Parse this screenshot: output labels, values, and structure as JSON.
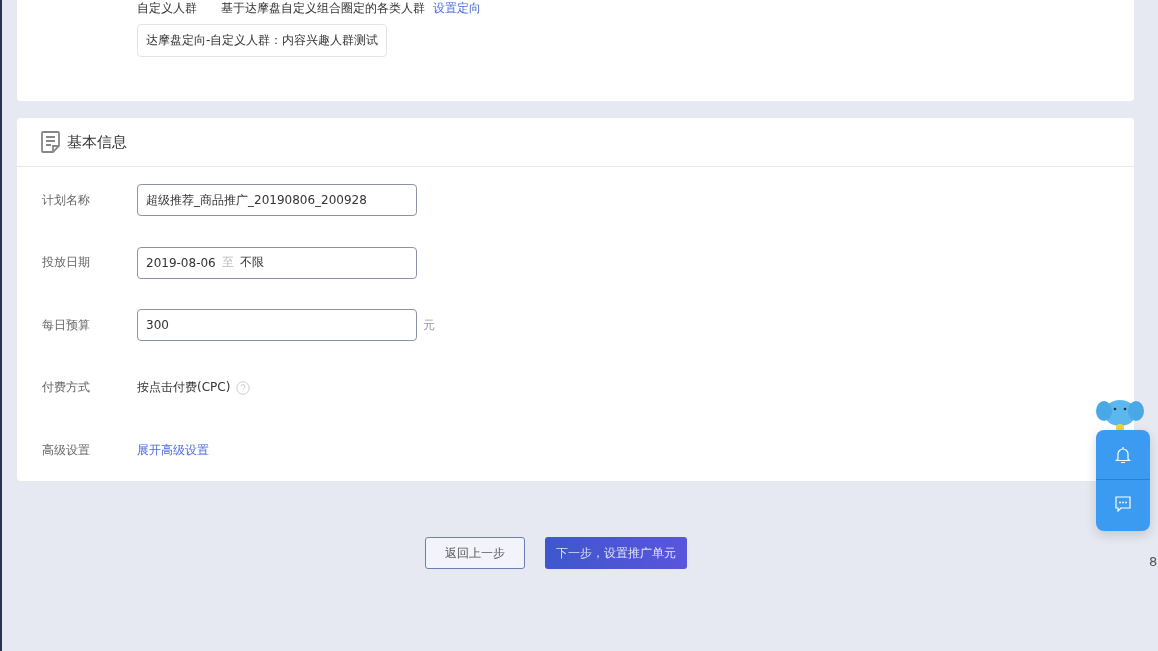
{
  "targeting": {
    "label": "自定义人群",
    "description": "基于达摩盘自定义组合圈定的各类人群",
    "link": "设置定向",
    "tag": "达摩盘定向-自定义人群：内容兴趣人群测试"
  },
  "basic_info": {
    "title": "基本信息",
    "rows": [
      {
        "kind": "input",
        "label": "计划名称",
        "value": "超级推荐_商品推广_20190806_200928"
      },
      {
        "kind": "date",
        "label": "投放日期",
        "start": "2019-08-06",
        "separator": "至",
        "end": "不限"
      },
      {
        "kind": "input",
        "label": "每日预算",
        "value": "300",
        "unit": "元"
      },
      {
        "kind": "text",
        "label": "付费方式",
        "value": "按点击付费(CPC)",
        "help": true
      },
      {
        "kind": "link",
        "label": "高级设置",
        "value": "展开高级设置"
      }
    ]
  },
  "buttons": {
    "back": "返回上一步",
    "next": "下一步，设置推广单元"
  },
  "edge_fragment": "8"
}
